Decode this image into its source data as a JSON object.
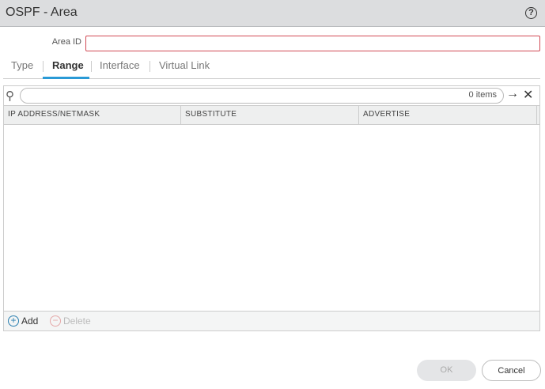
{
  "dialog": {
    "title": "OSPF - Area",
    "help_icon": "?"
  },
  "form": {
    "area_id_label": "Area ID",
    "area_id_value": ""
  },
  "tabs": [
    {
      "label": "Type"
    },
    {
      "label": "Range"
    },
    {
      "label": "Interface"
    },
    {
      "label": "Virtual Link"
    }
  ],
  "active_tab": "Range",
  "table": {
    "search_placeholder": "",
    "item_count": "0 items",
    "apply_icon": "→",
    "clear_icon": "✕",
    "columns": [
      "IP ADDRESS/NETMASK",
      "SUBSTITUTE",
      "ADVERTISE"
    ],
    "rows": []
  },
  "footer": {
    "add_label": "Add",
    "delete_label": "Delete"
  },
  "buttons": {
    "ok": "OK",
    "cancel": "Cancel"
  },
  "colors": {
    "accent": "#2a9ad6",
    "error_border": "#d14a55"
  }
}
